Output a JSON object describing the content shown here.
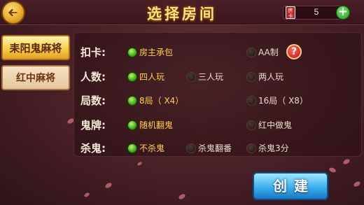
{
  "header": {
    "title": "选择房间",
    "card_icon_text": "房卡",
    "card_count": "5"
  },
  "tabs": [
    {
      "label": "耒阳鬼麻将",
      "active": true
    },
    {
      "label": "红中麻将",
      "active": false
    }
  ],
  "rows": {
    "pay": {
      "label": "扣卡:",
      "options": [
        {
          "label": "房主承包",
          "selected": true
        },
        {
          "label": "AA制",
          "selected": false
        }
      ],
      "help_label": "?"
    },
    "players": {
      "label": "人数:",
      "options": [
        {
          "label": "四人玩",
          "selected": true
        },
        {
          "label": "三人玩",
          "selected": false
        },
        {
          "label": "两人玩",
          "selected": false
        }
      ]
    },
    "rounds": {
      "label": "局数:",
      "options": [
        {
          "label": "8局（  X4）",
          "selected": true
        },
        {
          "label": "16局（  X8）",
          "selected": false
        }
      ]
    },
    "ghost": {
      "label": "鬼牌:",
      "options": [
        {
          "label": "随机翻鬼",
          "selected": true
        },
        {
          "label": "红中做鬼",
          "selected": false
        }
      ]
    },
    "kill": {
      "label": "杀鬼:",
      "options": [
        {
          "label": "不杀鬼",
          "selected": true
        },
        {
          "label": "杀鬼翻番",
          "selected": false
        },
        {
          "label": "杀鬼3分",
          "selected": false
        }
      ]
    }
  },
  "create_button": {
    "label": "创建"
  },
  "colors": {
    "selected_text": "#ffd24a",
    "unselected_text": "#e8dccb",
    "title": "#ffe27a",
    "create_button": "#3db0ec"
  }
}
